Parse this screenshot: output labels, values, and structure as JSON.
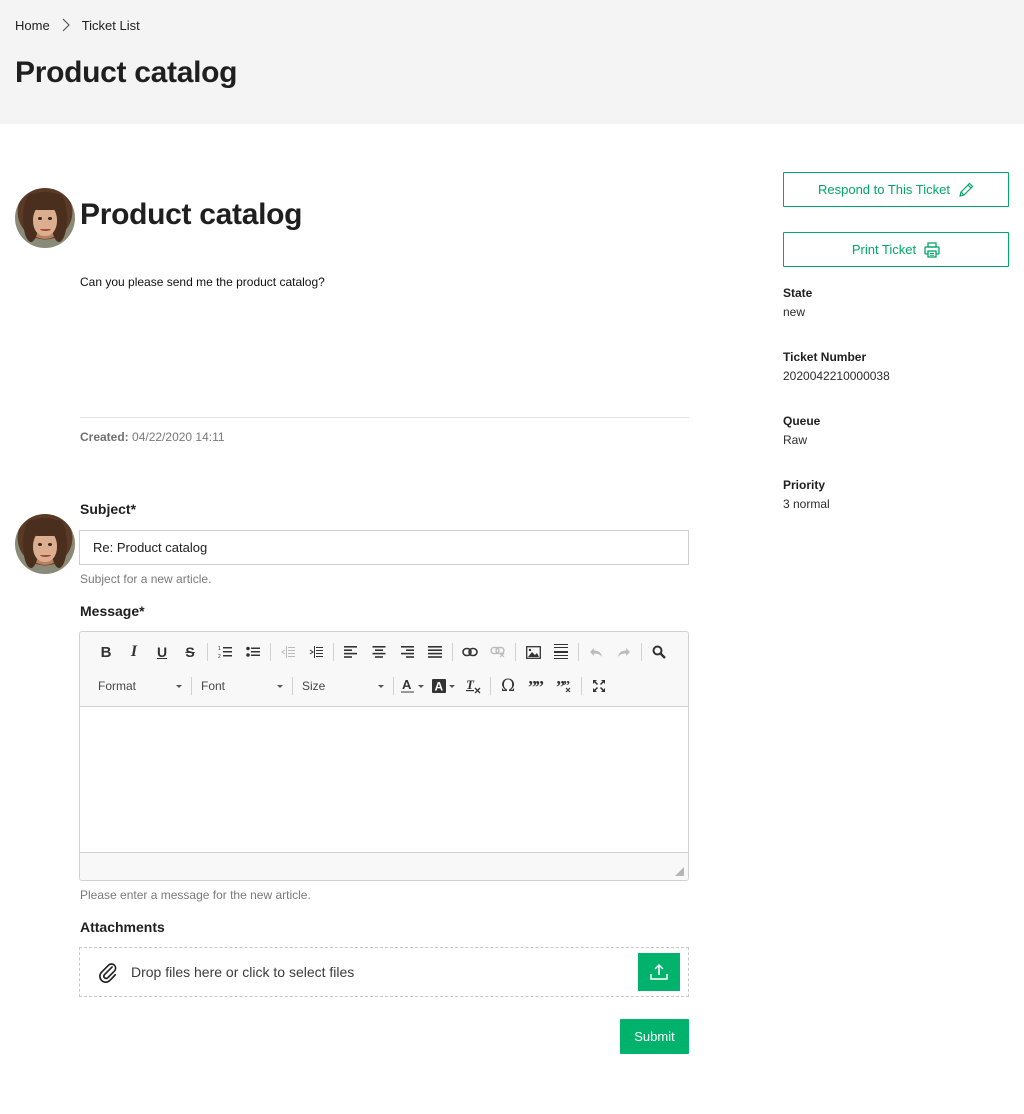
{
  "breadcrumb": {
    "items": [
      "Home",
      "Ticket List"
    ]
  },
  "header": {
    "title": "Product catalog"
  },
  "ticket": {
    "title": "Product catalog",
    "body": "Can you please send me the product catalog?",
    "created_label": "Created:",
    "created_value": "04/22/2020 14:11"
  },
  "reply_form": {
    "subject_label": "Subject*",
    "subject_value": "Re: Product catalog",
    "subject_help": "Subject for a new article.",
    "message_label": "Message*",
    "message_help": "Please enter a message for the new article.",
    "attachments_label": "Attachments",
    "dropzone_text": "Drop files here or click to select files",
    "submit_label": "Submit"
  },
  "editor": {
    "toolbar_row1": [
      {
        "icon": "bold-icon",
        "glyph": "B"
      },
      {
        "icon": "italic-icon",
        "glyph": "I"
      },
      {
        "icon": "underline-icon",
        "glyph": "U"
      },
      {
        "icon": "strikethrough-icon",
        "glyph": "S"
      },
      {
        "icon": "numbered-list-icon"
      },
      {
        "icon": "bulleted-list-icon"
      },
      {
        "icon": "outdent-icon",
        "disabled": true
      },
      {
        "icon": "indent-icon"
      },
      {
        "icon": "align-left-icon"
      },
      {
        "icon": "align-center-icon"
      },
      {
        "icon": "align-right-icon"
      },
      {
        "icon": "justify-icon"
      },
      {
        "icon": "link-icon"
      },
      {
        "icon": "unlink-icon",
        "disabled": true
      },
      {
        "icon": "image-icon"
      },
      {
        "icon": "horizontal-line-icon"
      },
      {
        "icon": "undo-icon",
        "disabled": true
      },
      {
        "icon": "redo-icon",
        "disabled": true
      },
      {
        "icon": "find-icon"
      }
    ],
    "format_label": "Format",
    "font_label": "Font",
    "size_label": "Size",
    "special_char_glyph": "Ω"
  },
  "sidebar": {
    "respond_label": "Respond to This Ticket",
    "print_label": "Print Ticket",
    "fields": [
      {
        "label": "State",
        "value": "new"
      },
      {
        "label": "Ticket Number",
        "value": "2020042210000038"
      },
      {
        "label": "Queue",
        "value": "Raw"
      },
      {
        "label": "Priority",
        "value": "3 normal"
      }
    ]
  },
  "colors": {
    "accent": "#00b26b",
    "header_bg": "#f4f4f4"
  }
}
